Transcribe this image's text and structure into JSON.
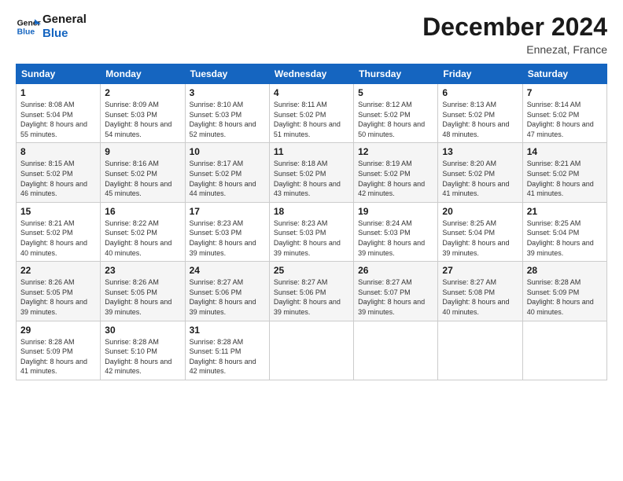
{
  "logo": {
    "line1": "General",
    "line2": "Blue"
  },
  "header": {
    "month": "December 2024",
    "location": "Ennezat, France"
  },
  "weekdays": [
    "Sunday",
    "Monday",
    "Tuesday",
    "Wednesday",
    "Thursday",
    "Friday",
    "Saturday"
  ],
  "weeks": [
    [
      {
        "day": "1",
        "sunrise": "8:08 AM",
        "sunset": "5:04 PM",
        "daylight": "8 hours and 55 minutes."
      },
      {
        "day": "2",
        "sunrise": "8:09 AM",
        "sunset": "5:03 PM",
        "daylight": "8 hours and 54 minutes."
      },
      {
        "day": "3",
        "sunrise": "8:10 AM",
        "sunset": "5:03 PM",
        "daylight": "8 hours and 52 minutes."
      },
      {
        "day": "4",
        "sunrise": "8:11 AM",
        "sunset": "5:02 PM",
        "daylight": "8 hours and 51 minutes."
      },
      {
        "day": "5",
        "sunrise": "8:12 AM",
        "sunset": "5:02 PM",
        "daylight": "8 hours and 50 minutes."
      },
      {
        "day": "6",
        "sunrise": "8:13 AM",
        "sunset": "5:02 PM",
        "daylight": "8 hours and 48 minutes."
      },
      {
        "day": "7",
        "sunrise": "8:14 AM",
        "sunset": "5:02 PM",
        "daylight": "8 hours and 47 minutes."
      }
    ],
    [
      {
        "day": "8",
        "sunrise": "8:15 AM",
        "sunset": "5:02 PM",
        "daylight": "8 hours and 46 minutes."
      },
      {
        "day": "9",
        "sunrise": "8:16 AM",
        "sunset": "5:02 PM",
        "daylight": "8 hours and 45 minutes."
      },
      {
        "day": "10",
        "sunrise": "8:17 AM",
        "sunset": "5:02 PM",
        "daylight": "8 hours and 44 minutes."
      },
      {
        "day": "11",
        "sunrise": "8:18 AM",
        "sunset": "5:02 PM",
        "daylight": "8 hours and 43 minutes."
      },
      {
        "day": "12",
        "sunrise": "8:19 AM",
        "sunset": "5:02 PM",
        "daylight": "8 hours and 42 minutes."
      },
      {
        "day": "13",
        "sunrise": "8:20 AM",
        "sunset": "5:02 PM",
        "daylight": "8 hours and 41 minutes."
      },
      {
        "day": "14",
        "sunrise": "8:21 AM",
        "sunset": "5:02 PM",
        "daylight": "8 hours and 41 minutes."
      }
    ],
    [
      {
        "day": "15",
        "sunrise": "8:21 AM",
        "sunset": "5:02 PM",
        "daylight": "8 hours and 40 minutes."
      },
      {
        "day": "16",
        "sunrise": "8:22 AM",
        "sunset": "5:02 PM",
        "daylight": "8 hours and 40 minutes."
      },
      {
        "day": "17",
        "sunrise": "8:23 AM",
        "sunset": "5:03 PM",
        "daylight": "8 hours and 39 minutes."
      },
      {
        "day": "18",
        "sunrise": "8:23 AM",
        "sunset": "5:03 PM",
        "daylight": "8 hours and 39 minutes."
      },
      {
        "day": "19",
        "sunrise": "8:24 AM",
        "sunset": "5:03 PM",
        "daylight": "8 hours and 39 minutes."
      },
      {
        "day": "20",
        "sunrise": "8:25 AM",
        "sunset": "5:04 PM",
        "daylight": "8 hours and 39 minutes."
      },
      {
        "day": "21",
        "sunrise": "8:25 AM",
        "sunset": "5:04 PM",
        "daylight": "8 hours and 39 minutes."
      }
    ],
    [
      {
        "day": "22",
        "sunrise": "8:26 AM",
        "sunset": "5:05 PM",
        "daylight": "8 hours and 39 minutes."
      },
      {
        "day": "23",
        "sunrise": "8:26 AM",
        "sunset": "5:05 PM",
        "daylight": "8 hours and 39 minutes."
      },
      {
        "day": "24",
        "sunrise": "8:27 AM",
        "sunset": "5:06 PM",
        "daylight": "8 hours and 39 minutes."
      },
      {
        "day": "25",
        "sunrise": "8:27 AM",
        "sunset": "5:06 PM",
        "daylight": "8 hours and 39 minutes."
      },
      {
        "day": "26",
        "sunrise": "8:27 AM",
        "sunset": "5:07 PM",
        "daylight": "8 hours and 39 minutes."
      },
      {
        "day": "27",
        "sunrise": "8:27 AM",
        "sunset": "5:08 PM",
        "daylight": "8 hours and 40 minutes."
      },
      {
        "day": "28",
        "sunrise": "8:28 AM",
        "sunset": "5:09 PM",
        "daylight": "8 hours and 40 minutes."
      }
    ],
    [
      {
        "day": "29",
        "sunrise": "8:28 AM",
        "sunset": "5:09 PM",
        "daylight": "8 hours and 41 minutes."
      },
      {
        "day": "30",
        "sunrise": "8:28 AM",
        "sunset": "5:10 PM",
        "daylight": "8 hours and 42 minutes."
      },
      {
        "day": "31",
        "sunrise": "8:28 AM",
        "sunset": "5:11 PM",
        "daylight": "8 hours and 42 minutes."
      },
      null,
      null,
      null,
      null
    ]
  ],
  "labels": {
    "sunrise": "Sunrise:",
    "sunset": "Sunset:",
    "daylight": "Daylight:"
  }
}
